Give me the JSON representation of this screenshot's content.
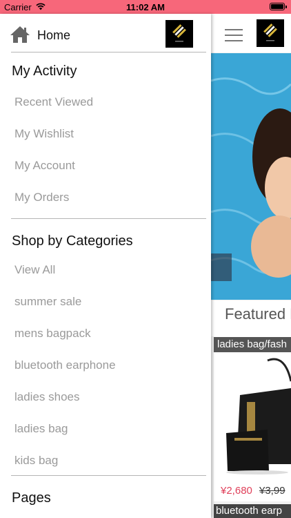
{
  "status_bar": {
    "carrier": "Carrier",
    "time": "11:02 AM",
    "wifi_icon": "wifi-icon",
    "battery_icon": "battery-icon",
    "color": "#f7677a"
  },
  "drawer": {
    "home_label": "Home",
    "home_icon": "home-icon",
    "logo_icon": "brand-logo",
    "my_activity": {
      "title": "My Activity",
      "items": [
        {
          "label": "Recent Viewed"
        },
        {
          "label": "My Wishlist"
        },
        {
          "label": "My Account"
        },
        {
          "label": "My Orders"
        }
      ]
    },
    "categories": {
      "title": "Shop by Categories",
      "items": [
        {
          "label": "View All"
        },
        {
          "label": "summer sale"
        },
        {
          "label": "mens bagpack"
        },
        {
          "label": "bluetooth earphone"
        },
        {
          "label": "ladies shoes"
        },
        {
          "label": "ladies bag"
        },
        {
          "label": "kids bag"
        }
      ]
    },
    "pages": {
      "title": "Pages"
    }
  },
  "main": {
    "menu_icon": "hamburger-menu-icon",
    "featured_title": "Featured P",
    "products": [
      {
        "name": "ladies bag/fash",
        "price": "¥2,680",
        "old_price": "¥3,99"
      },
      {
        "name": "bluetooth earp"
      }
    ]
  }
}
